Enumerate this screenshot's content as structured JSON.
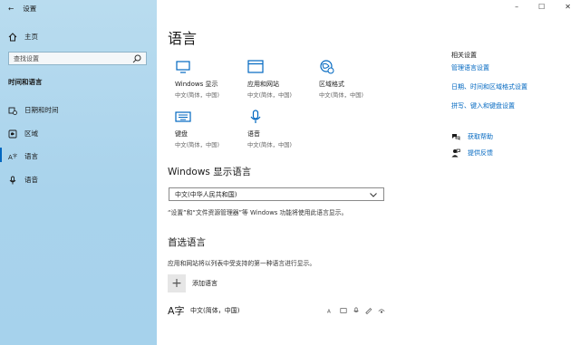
{
  "window": {
    "title": "设置",
    "controls": {
      "minimize": "–",
      "maximize": "☐",
      "close": "✕"
    }
  },
  "sidebar": {
    "home": "主页",
    "search_placeholder": "查找设置",
    "section": "时间和语言",
    "items": [
      {
        "label": "日期和时间",
        "icon": "calendar-clock-icon"
      },
      {
        "label": "区域",
        "icon": "globe-icon"
      },
      {
        "label": "语言",
        "icon": "language-icon",
        "active": true
      },
      {
        "label": "语音",
        "icon": "microphone-icon"
      }
    ]
  },
  "main": {
    "title": "语言",
    "tiles": [
      {
        "label": "Windows 显示",
        "sub": "中文(简体，中国)",
        "icon": "monitor-icon"
      },
      {
        "label": "应用和网站",
        "sub": "中文(简体，中国)",
        "icon": "app-window-icon"
      },
      {
        "label": "区域格式",
        "sub": "中文(简体，中国)",
        "icon": "region-format-icon"
      },
      {
        "label": "键盘",
        "sub": "中文(简体，中国)",
        "icon": "keyboard-icon"
      },
      {
        "label": "语音",
        "sub": "中文(简体，中国)",
        "icon": "microphone-icon"
      }
    ],
    "display_language": {
      "heading": "Windows 显示语言",
      "selected": "中文(中华人民共和国)",
      "note": "“设置”和“文件资源管理器”等 Windows 功能将使用此语言显示。"
    },
    "preferred": {
      "heading": "首选语言",
      "note": "应用和网站将以列表中受支持的第一种语言进行显示。",
      "add_label": "添加语言",
      "languages": [
        {
          "name": "中文(简体，中国)",
          "glyph": "A字"
        }
      ]
    }
  },
  "related": {
    "heading": "相关设置",
    "links": [
      "管理语言设置",
      "日期、时间和区域格式设置",
      "拼写、键入和键盘设置"
    ],
    "help": [
      {
        "label": "获取帮助",
        "icon": "help-chat-icon"
      },
      {
        "label": "提供反馈",
        "icon": "feedback-icon"
      }
    ]
  },
  "colors": {
    "accent": "#0067c0",
    "sidebar": "#b9dcef"
  }
}
